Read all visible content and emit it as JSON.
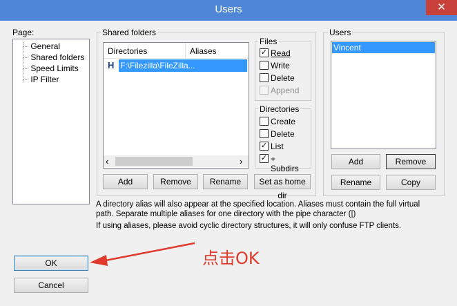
{
  "window": {
    "title": "Users",
    "close_glyph": "✕"
  },
  "page_panel": {
    "label": "Page:",
    "items": [
      "General",
      "Shared folders",
      "Speed Limits",
      "IP Filter"
    ]
  },
  "shared": {
    "group_label": "Shared folders",
    "columns": [
      "Directories",
      "Aliases"
    ],
    "row": {
      "marker": "H",
      "directory": "F:\\Filezilla\\FileZilla..."
    },
    "buttons": {
      "add": "Add",
      "remove": "Remove",
      "rename": "Rename",
      "home": "Set as home dir"
    },
    "scroll_left": "‹",
    "scroll_right": "›"
  },
  "files": {
    "label": "Files",
    "read": "Read",
    "write": "Write",
    "delete": "Delete",
    "append": "Append",
    "checked": {
      "read": true,
      "write": false,
      "delete": false,
      "append": false
    }
  },
  "directories": {
    "label": "Directories",
    "create": "Create",
    "delete": "Delete",
    "list": "List",
    "subdirs": "+ Subdirs",
    "checked": {
      "create": false,
      "delete": false,
      "list": true,
      "subdirs": true
    }
  },
  "users": {
    "label": "Users",
    "list": [
      "Vincent"
    ],
    "buttons": {
      "add": "Add",
      "remove": "Remove",
      "rename": "Rename",
      "copy": "Copy"
    }
  },
  "info": {
    "line1": "A directory alias will also appear at the specified location. Aliases must contain the full virtual",
    "line2": "path. Separate multiple aliases for one directory with the pipe character (|)",
    "line3": "If using aliases, please avoid cyclic directory structures, it will only confuse FTP clients."
  },
  "dialog_buttons": {
    "ok": "OK",
    "cancel": "Cancel"
  },
  "annotation": {
    "text": "点击OK",
    "color": "#e03a2c"
  },
  "check_glyph": "✓"
}
